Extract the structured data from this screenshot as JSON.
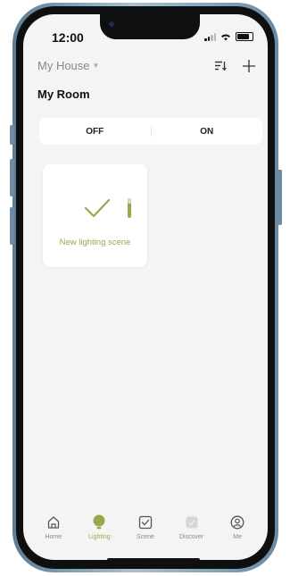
{
  "status": {
    "time": "12:00"
  },
  "header": {
    "house_name": "My House",
    "sort_icon": "sort-icon",
    "add_icon": "plus-icon"
  },
  "room": {
    "title": "My Room"
  },
  "power": {
    "off_label": "OFF",
    "on_label": "ON"
  },
  "scene": {
    "label": "New lighting scene",
    "icon": "check-icon"
  },
  "tabs": [
    {
      "label": "Home",
      "icon": "home-icon",
      "active": false
    },
    {
      "label": "Lighting",
      "icon": "bulb-icon",
      "active": true
    },
    {
      "label": "Scene",
      "icon": "scene-check-icon",
      "active": false
    },
    {
      "label": "Discover",
      "icon": "discover-icon",
      "active": false
    },
    {
      "label": "Me",
      "icon": "profile-icon",
      "active": false
    }
  ],
  "colors": {
    "accent": "#97a94b",
    "background": "#f4f4f4",
    "card": "#ffffff",
    "frame": "#8fa9bc"
  }
}
